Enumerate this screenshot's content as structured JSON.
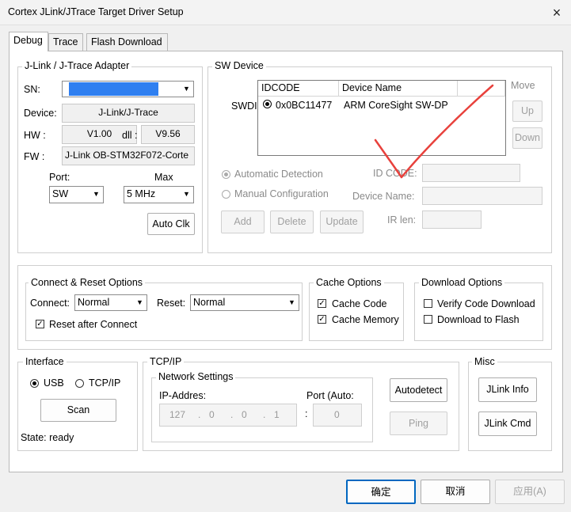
{
  "window": {
    "title": "Cortex JLink/JTrace Target Driver Setup",
    "close_icon": "×"
  },
  "tabs": [
    "Debug",
    "Trace",
    "Flash Download"
  ],
  "adapter": {
    "legend": "J-Link / J-Trace Adapter",
    "sn_label": "SN:",
    "device_label": "Device:",
    "device_value": "J-Link/J-Trace",
    "hw_label": "HW :",
    "hw_value": "V1.00",
    "dll_label": "dll :",
    "dll_value": "V9.56",
    "fw_label": "FW :",
    "fw_value": "J-Link OB-STM32F072-Corte",
    "port_label": "Port:",
    "port_value": "SW",
    "max_label": "Max",
    "max_value": "5 MHz",
    "auto_clk": "Auto Clk"
  },
  "sw_device": {
    "legend": "SW Device",
    "swdi_label": "SWDI",
    "col_idcode": "IDCODE",
    "col_device_name": "Device Name",
    "rows": [
      {
        "idcode": "0x0BC11477",
        "device_name": "ARM CoreSight SW-DP"
      }
    ],
    "move_label": "Move",
    "up": "Up",
    "down": "Down",
    "auto_detection": "Automatic Detection",
    "manual_config": "Manual Configuration",
    "id_code_label": "ID CODE:",
    "device_name_label": "Device Name:",
    "ir_len_label": "IR len:",
    "add": "Add",
    "delete": "Delete",
    "update": "Update"
  },
  "connect_reset": {
    "legend": "Connect & Reset Options",
    "connect_label": "Connect:",
    "connect_value": "Normal",
    "reset_label": "Reset:",
    "reset_value": "Normal",
    "reset_after_connect": "Reset after Connect"
  },
  "cache": {
    "legend": "Cache Options",
    "code": "Cache Code",
    "memory": "Cache Memory"
  },
  "download": {
    "legend": "Download Options",
    "verify": "Verify Code Download",
    "to_flash": "Download to Flash"
  },
  "interface": {
    "legend": "Interface",
    "usb": "USB",
    "tcpip": "TCP/IP",
    "scan": "Scan",
    "state": "State: ready"
  },
  "tcpip": {
    "legend": "TCP/IP",
    "network_legend": "Network Settings",
    "ip_label": "IP-Addres:",
    "ip": [
      "127",
      "0",
      "0",
      "1"
    ],
    "port_label": "Port (Auto:",
    "port_value": "0",
    "autodetect": "Autodetect",
    "ping": "Ping"
  },
  "misc": {
    "legend": "Misc",
    "jlink_info": "JLink Info",
    "jlink_cmd": "JLink Cmd"
  },
  "footer": {
    "ok": "确定",
    "cancel": "取消",
    "apply": "应用(A)"
  },
  "annotation_color": "#e8413c"
}
